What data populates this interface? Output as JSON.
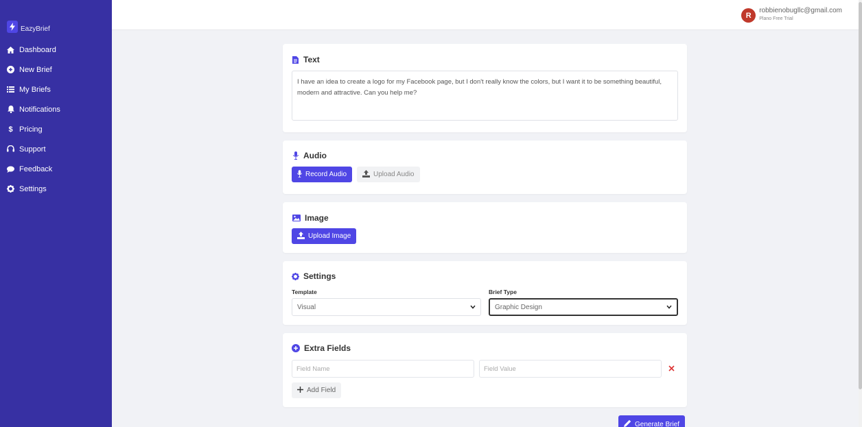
{
  "app": {
    "name": "EazyBrief"
  },
  "sidebar": {
    "items": [
      {
        "label": "Dashboard",
        "icon": "home-icon"
      },
      {
        "label": "New Brief",
        "icon": "plus-circle-icon"
      },
      {
        "label": "My Briefs",
        "icon": "list-icon"
      },
      {
        "label": "Notifications",
        "icon": "bell-icon"
      },
      {
        "label": "Pricing",
        "icon": "dollar-icon"
      },
      {
        "label": "Support",
        "icon": "headset-icon"
      },
      {
        "label": "Feedback",
        "icon": "comment-icon"
      },
      {
        "label": "Settings",
        "icon": "gear-icon"
      }
    ]
  },
  "user": {
    "initial": "R",
    "email": "robbienobugllc@gmail.com",
    "plan": "Plano Free Trial"
  },
  "text_section": {
    "title": "Text",
    "value": "I have an idea to create a logo for my Facebook page, but I don't really know the colors, but I want it to be something beautiful, modern and attractive. Can you help me?"
  },
  "audio_section": {
    "title": "Audio",
    "record_label": "Record Audio",
    "upload_label": "Upload Audio"
  },
  "image_section": {
    "title": "Image",
    "upload_label": "Upload Image"
  },
  "settings_section": {
    "title": "Settings",
    "template_label": "Template",
    "template_value": "Visual",
    "brief_type_label": "Brief Type",
    "brief_type_value": "Graphic Design"
  },
  "extra_fields": {
    "title": "Extra Fields",
    "name_placeholder": "Field Name",
    "value_placeholder": "Field Value",
    "add_label": "Add Field"
  },
  "actions": {
    "generate_label": "Generate Brief"
  },
  "colors": {
    "sidebar": "#3730a3",
    "primary": "#4f46e5",
    "danger": "#dd3333"
  }
}
